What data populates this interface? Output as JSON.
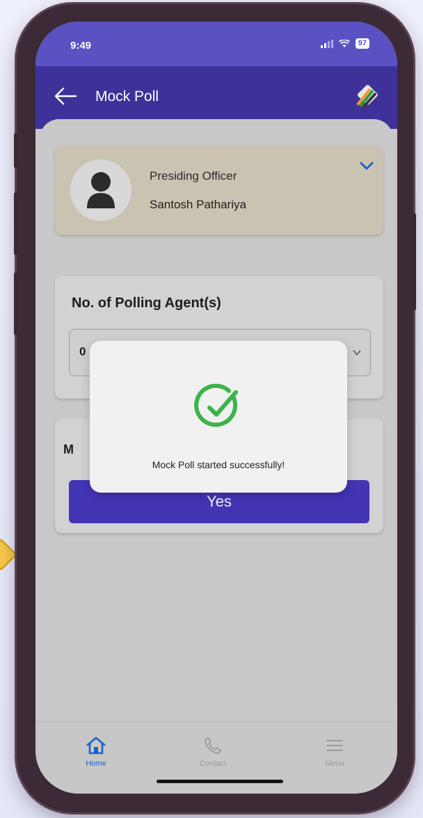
{
  "status_bar": {
    "time": "9:49",
    "battery": "97"
  },
  "app_bar": {
    "title": "Mock Poll"
  },
  "officer": {
    "role": "Presiding Officer",
    "name": "Santosh Pathariya"
  },
  "agents": {
    "title": "No. of Polling Agent(s)",
    "selected": "0"
  },
  "mock_poll": {
    "label_visible": "M",
    "yes_label": "Yes"
  },
  "toast": {
    "message": "Mock Poll started successfully!"
  },
  "nav": {
    "home": "Home",
    "contact": "Contact",
    "menu": "Menu"
  },
  "colors": {
    "primary": "#3e329a",
    "status_bar": "#5a52c2",
    "button": "#4234b3",
    "success": "#3cb34a",
    "home_active": "#1a61c7"
  }
}
